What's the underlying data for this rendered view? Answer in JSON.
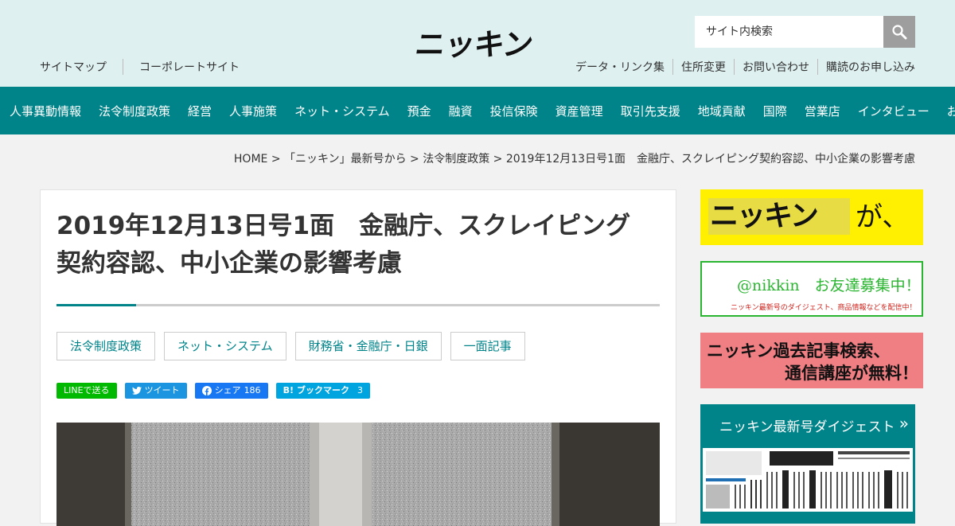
{
  "header": {
    "logo": "ニッキン",
    "search": {
      "placeholder": "サイト内検索"
    },
    "sub_left": [
      "サイトマップ",
      "コーポレートサイト"
    ],
    "sub_right": [
      "データ・リンク集",
      "住所変更",
      "お問い合わせ",
      "購読のお申し込み"
    ]
  },
  "nav": [
    "人事異動情報",
    "法令制度政策",
    "経営",
    "人事施策",
    "ネット・システム",
    "預金",
    "融資",
    "投信保険",
    "資産管理",
    "取引先支援",
    "地域貢献",
    "国際",
    "営業店",
    "インタビュー",
    "おくやみ"
  ],
  "breadcrumb": "HOME > 「ニッキン」最新号から > 法令制度政策 > 2019年12月13日号1面　金融庁、スクレイピング契約容認、中小企業の影響考慮",
  "article": {
    "title_line1": "2019年12月13日号1面　金融庁、スクレイピング",
    "title_line2": "契約容認、中小企業の影響考慮",
    "tags": [
      "法令制度政策",
      "ネット・システム",
      "財務省・金融庁・日銀",
      "一面記事"
    ],
    "share": {
      "line": "LINEで送る",
      "tweet": "ツイート",
      "fb": "シェア",
      "fb_count": "186",
      "hatena": "ブックマーク",
      "hatena_count": "3"
    }
  },
  "sidebar": {
    "banner1_logo": "ニッキン",
    "banner1_text": "が、",
    "banner2_main": "@nikkin　お友達募集中！",
    "banner2_sub": "ニッキン最新号のダイジェスト、商品情報などを配信中！",
    "banner3_line1": "ニッキン過去記事検索、",
    "banner3_line2": "通信講座が無料！",
    "digest_title": "ニッキン最新号ダイジェスト",
    "digest_chevron": "»"
  },
  "colors": {
    "teal": "#00848a",
    "header_bg": "#dff0f0",
    "line_green": "#00b900",
    "twitter": "#1b95e0",
    "facebook": "#1877f2",
    "hatena": "#00a4de"
  }
}
